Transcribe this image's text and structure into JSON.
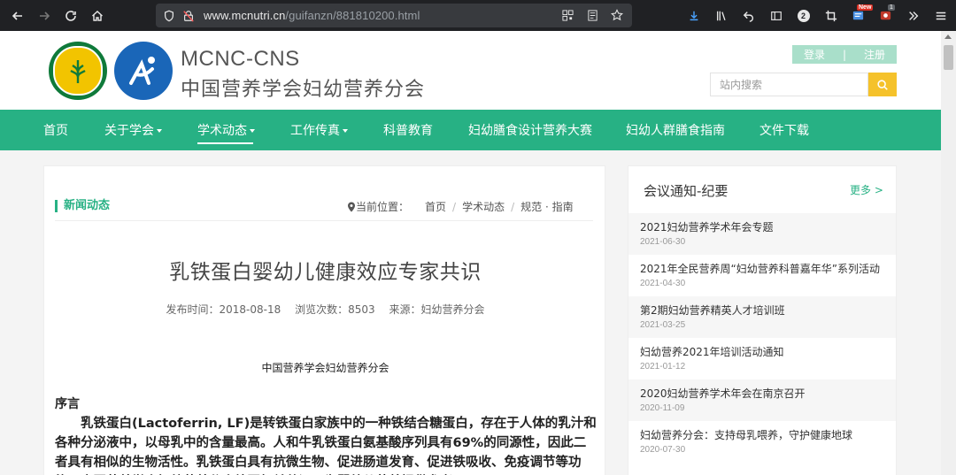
{
  "browser": {
    "url_host": "www.mcnutri.cn",
    "url_path": "/guifanzn/881810200.html",
    "badge_count": "2",
    "new_badge": "New",
    "ext_badge": "1"
  },
  "header": {
    "brand_en": "MCNC-CNS",
    "brand_cn": "中国营养学会妇幼营养分会",
    "login": "登录",
    "divider": "|",
    "register": "注册",
    "search_placeholder": "站内搜索"
  },
  "nav": {
    "items": [
      {
        "label": "首页"
      },
      {
        "label": "关于学会"
      },
      {
        "label": "学术动态"
      },
      {
        "label": "工作传真"
      },
      {
        "label": "科普教育"
      },
      {
        "label": "妇幼膳食设计营养大赛"
      },
      {
        "label": "妇幼人群膳食指南"
      },
      {
        "label": "文件下载"
      }
    ]
  },
  "article": {
    "section": "新闻动态",
    "crumb_label": "当前位置：",
    "crumbs": [
      "首页",
      "学术动态",
      "规范 · 指南"
    ],
    "title": "乳铁蛋白婴幼儿健康效应专家共识",
    "publish_time": "发布时间：2018-08-18",
    "views": "浏览次数：8503",
    "source": "来源：妇幼营养分会",
    "org": "中国营养学会妇幼营养分会",
    "preface": "序言",
    "body": "乳铁蛋白(Lactoferrin, LF)是转铁蛋白家族中的一种铁结合糖蛋白，存在于人体的乳汁和各种分泌液中，以母乳中的含量最高。人和牛乳铁蛋白氨基酸序列具有69%的同源性，因此二者具有相似的生物活性。乳铁蛋白具有抗微生物、促进肠道发育、促进铁吸收、免疫调节等功能。中国营养学会妇幼营养分会编写相关共识，为婴幼儿营养提供参考。"
  },
  "sidebar": {
    "title": "会议通知-纪要",
    "more": "更多 >",
    "items": [
      {
        "title": "2021妇幼营养学术年会专题",
        "date": "2021-06-30"
      },
      {
        "title": "2021年全民营养周“妇幼营养科普嘉年华”系列活动",
        "date": "2021-04-30"
      },
      {
        "title": "第2期妇幼营养精英人才培训班",
        "date": "2021-03-25"
      },
      {
        "title": "妇幼营养2021年培训活动通知",
        "date": "2021-01-12"
      },
      {
        "title": "2020妇幼营养学术年会在南京召开",
        "date": "2020-11-09"
      },
      {
        "title": "妇幼营养分会：支持母乳喂养，守护健康地球",
        "date": "2020-07-30"
      }
    ]
  }
}
